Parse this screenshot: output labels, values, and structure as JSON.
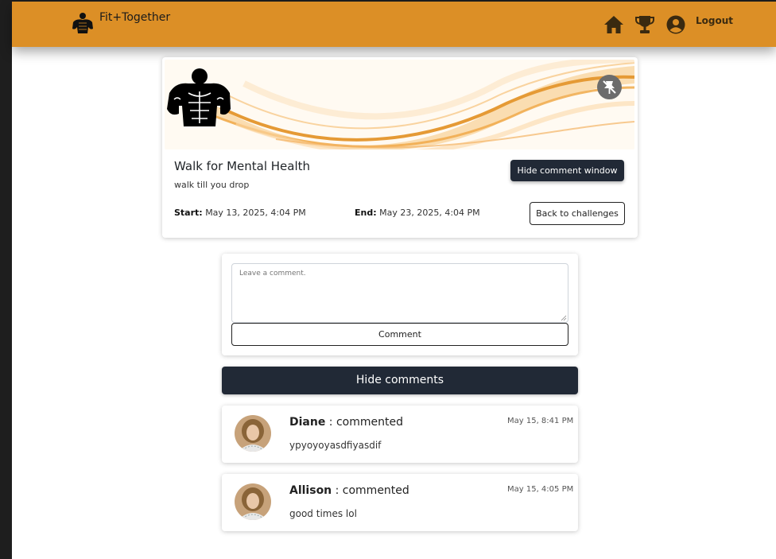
{
  "navbar": {
    "brand": "Fit+Together",
    "logout_label": "Logout",
    "accent_color": "#dc8f26"
  },
  "challenge": {
    "title": "Walk for Mental Health",
    "description": "walk till you drop",
    "hide_comment_window_label": "Hide comment window",
    "start_label": "Start:",
    "start_value": "May 13, 2025, 4:04 PM",
    "end_label": "End:",
    "end_value": "May 23, 2025, 4:04 PM",
    "back_label": "Back to challenges"
  },
  "comment_form": {
    "placeholder": "Leave a comment.",
    "submit_label": "Comment"
  },
  "hide_comments_label": "Hide comments",
  "comments": [
    {
      "user": "Diane",
      "verb": ": commented",
      "time": "May 15, 8:41 PM",
      "text": "ypyoyoyasdfiyasdif"
    },
    {
      "user": "Allison",
      "verb": ": commented",
      "time": "May 15, 4:05 PM",
      "text": "good times lol"
    }
  ]
}
